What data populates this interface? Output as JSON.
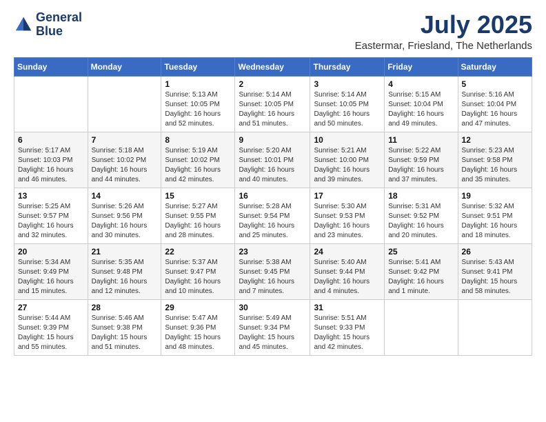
{
  "header": {
    "logo_line1": "General",
    "logo_line2": "Blue",
    "month": "July 2025",
    "location": "Eastermar, Friesland, The Netherlands"
  },
  "days_of_week": [
    "Sunday",
    "Monday",
    "Tuesday",
    "Wednesday",
    "Thursday",
    "Friday",
    "Saturday"
  ],
  "weeks": [
    {
      "days": [
        {
          "num": "",
          "info": ""
        },
        {
          "num": "",
          "info": ""
        },
        {
          "num": "1",
          "info": "Sunrise: 5:13 AM\nSunset: 10:05 PM\nDaylight: 16 hours and 52 minutes."
        },
        {
          "num": "2",
          "info": "Sunrise: 5:14 AM\nSunset: 10:05 PM\nDaylight: 16 hours and 51 minutes."
        },
        {
          "num": "3",
          "info": "Sunrise: 5:14 AM\nSunset: 10:05 PM\nDaylight: 16 hours and 50 minutes."
        },
        {
          "num": "4",
          "info": "Sunrise: 5:15 AM\nSunset: 10:04 PM\nDaylight: 16 hours and 49 minutes."
        },
        {
          "num": "5",
          "info": "Sunrise: 5:16 AM\nSunset: 10:04 PM\nDaylight: 16 hours and 47 minutes."
        }
      ]
    },
    {
      "days": [
        {
          "num": "6",
          "info": "Sunrise: 5:17 AM\nSunset: 10:03 PM\nDaylight: 16 hours and 46 minutes."
        },
        {
          "num": "7",
          "info": "Sunrise: 5:18 AM\nSunset: 10:02 PM\nDaylight: 16 hours and 44 minutes."
        },
        {
          "num": "8",
          "info": "Sunrise: 5:19 AM\nSunset: 10:02 PM\nDaylight: 16 hours and 42 minutes."
        },
        {
          "num": "9",
          "info": "Sunrise: 5:20 AM\nSunset: 10:01 PM\nDaylight: 16 hours and 40 minutes."
        },
        {
          "num": "10",
          "info": "Sunrise: 5:21 AM\nSunset: 10:00 PM\nDaylight: 16 hours and 39 minutes."
        },
        {
          "num": "11",
          "info": "Sunrise: 5:22 AM\nSunset: 9:59 PM\nDaylight: 16 hours and 37 minutes."
        },
        {
          "num": "12",
          "info": "Sunrise: 5:23 AM\nSunset: 9:58 PM\nDaylight: 16 hours and 35 minutes."
        }
      ]
    },
    {
      "days": [
        {
          "num": "13",
          "info": "Sunrise: 5:25 AM\nSunset: 9:57 PM\nDaylight: 16 hours and 32 minutes."
        },
        {
          "num": "14",
          "info": "Sunrise: 5:26 AM\nSunset: 9:56 PM\nDaylight: 16 hours and 30 minutes."
        },
        {
          "num": "15",
          "info": "Sunrise: 5:27 AM\nSunset: 9:55 PM\nDaylight: 16 hours and 28 minutes."
        },
        {
          "num": "16",
          "info": "Sunrise: 5:28 AM\nSunset: 9:54 PM\nDaylight: 16 hours and 25 minutes."
        },
        {
          "num": "17",
          "info": "Sunrise: 5:30 AM\nSunset: 9:53 PM\nDaylight: 16 hours and 23 minutes."
        },
        {
          "num": "18",
          "info": "Sunrise: 5:31 AM\nSunset: 9:52 PM\nDaylight: 16 hours and 20 minutes."
        },
        {
          "num": "19",
          "info": "Sunrise: 5:32 AM\nSunset: 9:51 PM\nDaylight: 16 hours and 18 minutes."
        }
      ]
    },
    {
      "days": [
        {
          "num": "20",
          "info": "Sunrise: 5:34 AM\nSunset: 9:49 PM\nDaylight: 16 hours and 15 minutes."
        },
        {
          "num": "21",
          "info": "Sunrise: 5:35 AM\nSunset: 9:48 PM\nDaylight: 16 hours and 12 minutes."
        },
        {
          "num": "22",
          "info": "Sunrise: 5:37 AM\nSunset: 9:47 PM\nDaylight: 16 hours and 10 minutes."
        },
        {
          "num": "23",
          "info": "Sunrise: 5:38 AM\nSunset: 9:45 PM\nDaylight: 16 hours and 7 minutes."
        },
        {
          "num": "24",
          "info": "Sunrise: 5:40 AM\nSunset: 9:44 PM\nDaylight: 16 hours and 4 minutes."
        },
        {
          "num": "25",
          "info": "Sunrise: 5:41 AM\nSunset: 9:42 PM\nDaylight: 16 hours and 1 minute."
        },
        {
          "num": "26",
          "info": "Sunrise: 5:43 AM\nSunset: 9:41 PM\nDaylight: 15 hours and 58 minutes."
        }
      ]
    },
    {
      "days": [
        {
          "num": "27",
          "info": "Sunrise: 5:44 AM\nSunset: 9:39 PM\nDaylight: 15 hours and 55 minutes."
        },
        {
          "num": "28",
          "info": "Sunrise: 5:46 AM\nSunset: 9:38 PM\nDaylight: 15 hours and 51 minutes."
        },
        {
          "num": "29",
          "info": "Sunrise: 5:47 AM\nSunset: 9:36 PM\nDaylight: 15 hours and 48 minutes."
        },
        {
          "num": "30",
          "info": "Sunrise: 5:49 AM\nSunset: 9:34 PM\nDaylight: 15 hours and 45 minutes."
        },
        {
          "num": "31",
          "info": "Sunrise: 5:51 AM\nSunset: 9:33 PM\nDaylight: 15 hours and 42 minutes."
        },
        {
          "num": "",
          "info": ""
        },
        {
          "num": "",
          "info": ""
        }
      ]
    }
  ]
}
